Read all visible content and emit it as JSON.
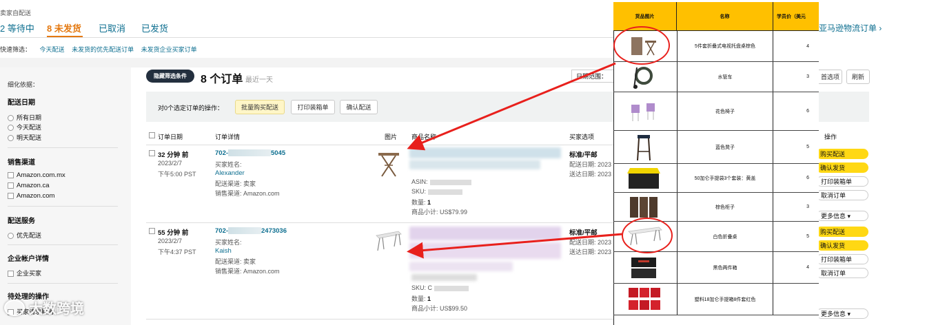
{
  "header": {
    "seller_label": "卖家自配送"
  },
  "tabs": [
    {
      "label": "2 等待中",
      "active": false
    },
    {
      "label": "8 未发货",
      "active": true
    },
    {
      "label": "已取消",
      "active": false
    },
    {
      "label": "已发货",
      "active": false
    }
  ],
  "quick_filter": {
    "label": "快速筛选：",
    "items": [
      "今天配送",
      "未发货的优先配送订单",
      "未发货企业买家订单"
    ]
  },
  "sidebar": {
    "title": "细化依据：",
    "sections": [
      {
        "title": "配送日期",
        "type": "radio",
        "items": [
          "所有日期",
          "今天配送",
          "明天配送"
        ]
      },
      {
        "title": "销售渠道",
        "type": "checkbox",
        "items": [
          "Amazon.com.mx",
          "Amazon.ca",
          "Amazon.com"
        ]
      },
      {
        "title": "配送服务",
        "type": "radio",
        "items": [
          "优先配送"
        ]
      },
      {
        "title": "企业帐户详情",
        "type": "checkbox",
        "items": [
          "企业买家"
        ]
      },
      {
        "title": "待处理的操作",
        "type": "checkbox",
        "items": [
          "买家请求取消"
        ]
      }
    ]
  },
  "orders_header": {
    "hide_filters_label": "隐藏筛选条件",
    "count_label": "8 个订单",
    "range_label": "最近一天",
    "date_range_label": "日期范围：",
    "settings_label": "首选项",
    "refresh_label": "刷新",
    "external_link": "亚马逊物流订单 ›"
  },
  "bulk_actions": {
    "label": "对0个选定订单的操作：",
    "buy_shipping": "批量购买配送",
    "print_slips": "打印装箱单",
    "confirm_shipment": "确认配送"
  },
  "columns": [
    "订单日期",
    "订单详情",
    "图片",
    "商品名称",
    "买家选项",
    "操作"
  ],
  "orders": [
    {
      "ago": "32 分钟 前",
      "date": "2023/2/7",
      "time": "下午5:00 PST",
      "order_id_prefix": "702-",
      "order_id_suffix": "5045",
      "buyer_label": "买家姓名:",
      "buyer": "Alexander",
      "ship_by": "配送渠道: 卖家",
      "channel": "销售渠道: Amazon.com",
      "asin": "ASIN:",
      "sku": "SKU:",
      "qty_label": "数量:",
      "qty": "1",
      "subtotal": "商品小计: US$79.99",
      "shipping_option": "标准/平邮",
      "ship_date": "配送日期: 2023",
      "deliver_date": "送达日期: 2023"
    },
    {
      "ago": "55 分钟 前",
      "date": "2023/2/7",
      "time": "下午4:37 PST",
      "order_id_prefix": "702-",
      "order_id_suffix": "2473036",
      "buyer_label": "买家姓名:",
      "buyer": "Kaish",
      "ship_by": "配送渠道: 卖家",
      "channel": "销售渠道: Amazon.com",
      "asin": "",
      "sku": "SKU: C",
      "qty_label": "数量:",
      "qty": "1",
      "subtotal": "商品小计: US$99.50",
      "shipping_option": "标准/平邮",
      "ship_date": "配送日期: 2023",
      "deliver_date": "送达日期: 2023"
    }
  ],
  "action_buttons": {
    "buy": "购买配送",
    "confirm": "确认发货",
    "print": "打印装箱单",
    "cancel": "取消订单",
    "more": "更多信息 ▾"
  },
  "overlay_table": {
    "headers": [
      "货品图片",
      "名称",
      "学员价（美元"
    ],
    "rows": [
      {
        "name": "5件套折叠式电视托盘桌棕色",
        "price": "4",
        "icon": "folding-tray-table-icon"
      },
      {
        "name": "水管车",
        "price": "3",
        "icon": "hose-cart-icon"
      },
      {
        "name": "花色椅子",
        "price": "6",
        "icon": "purple-chairs-icon"
      },
      {
        "name": "蓝色凳子",
        "price": "5",
        "icon": "bar-stool-icon"
      },
      {
        "name": "50加仑手提袋3个套装：黄盖",
        "price": "6",
        "icon": "storage-tote-icon"
      },
      {
        "name": "棕色柜子",
        "price": "3",
        "icon": "brown-cabinet-icon"
      },
      {
        "name": "白色折叠桌",
        "price": "5",
        "icon": "white-folding-table-icon"
      },
      {
        "name": "黑色两件箱",
        "price": "4",
        "icon": "black-box-icon"
      },
      {
        "name": "塑料18加仑手提箱8件套红色",
        "price": "",
        "icon": "red-bins-icon"
      }
    ]
  },
  "watermark": "大数跨境",
  "colors": {
    "accent": "#e47911",
    "table_header": "#ffc000",
    "annotation": "#e8201c",
    "link": "#0e6f90"
  }
}
